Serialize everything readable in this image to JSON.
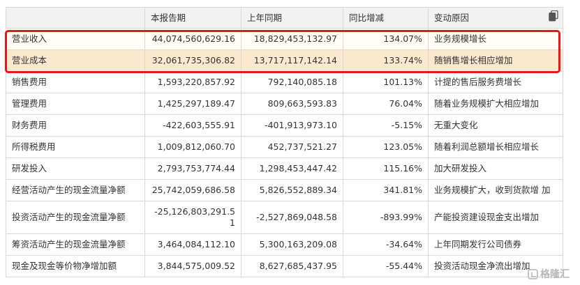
{
  "table": {
    "headers": [
      "",
      "本报告期",
      "上年同期",
      "同比增减",
      "变动原因"
    ],
    "rows": [
      {
        "label": "营业收入",
        "current": "44,074,560,629.16",
        "previous": "18,829,453,132.97",
        "change": "134.07%",
        "reason": "业务规模增长"
      },
      {
        "label": "营业成本",
        "current": "32,061,735,306.82",
        "previous": "13,717,117,142.14",
        "change": "133.74%",
        "reason": "随销售增长相应增加"
      },
      {
        "label": "销售费用",
        "current": "1,593,220,857.92",
        "previous": "792,140,085.18",
        "change": "101.13%",
        "reason": "计提的售后服务费增长"
      },
      {
        "label": "管理费用",
        "current": "1,425,297,189.47",
        "previous": "809,663,593.83",
        "change": "76.04%",
        "reason": "随着业务规模扩大相应增加"
      },
      {
        "label": "财务费用",
        "current": "-422,603,555.91",
        "previous": "-401,913,973.10",
        "change": "-5.15%",
        "reason": "无重大变化"
      },
      {
        "label": "所得税费用",
        "current": "1,009,812,060.70",
        "previous": "452,737,521.27",
        "change": "123.05%",
        "reason": "随着利润总额增长相应增长"
      },
      {
        "label": "研发投入",
        "current": "2,793,753,774.44",
        "previous": "1,298,453,447.42",
        "change": "115.16%",
        "reason": "加大研发投入"
      },
      {
        "label": "经营活动产生的现金流量净额",
        "current": "25,742,059,686.58",
        "previous": "5,826,552,889.34",
        "change": "341.81%",
        "reason": "业务规模扩大，收到货款增 加"
      },
      {
        "label": "投资活动产生的现金流量净额",
        "current": "-25,126,803,291.51",
        "previous": "-2,527,869,048.58",
        "change": "-893.99%",
        "reason": "产能投资建设现金支出增加"
      },
      {
        "label": "筹资活动产生的现金流量净额",
        "current": "3,464,084,112.10",
        "previous": "5,300,163,209.08",
        "change": "-34.64%",
        "reason": "上年同期发行公司债券"
      },
      {
        "label": "现金及现金等价物净增加额",
        "current": "3,844,575,009.52",
        "previous": "8,627,685,437.95",
        "change": "-55.44%",
        "reason": "投资活动现金净流出增加"
      }
    ]
  },
  "toolbar": {
    "copy_icon": "copy-icon"
  },
  "watermark": {
    "text": "格隆汇",
    "icon": "gelonghui-logo"
  },
  "colors": {
    "highlight_box": "#e5191c",
    "highlight_row": "#fce8cf",
    "header_bg": "#f2f2f2",
    "border": "#d9d9d9"
  }
}
